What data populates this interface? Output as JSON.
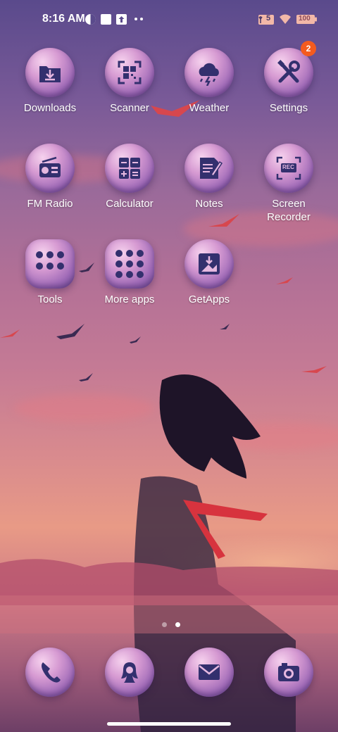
{
  "status_bar": {
    "time": "8:16 AM",
    "sim_label": "5",
    "battery_label": "100"
  },
  "apps": [
    {
      "label": "Downloads",
      "icon": "download-icon"
    },
    {
      "label": "Scanner",
      "icon": "qr-scanner-icon"
    },
    {
      "label": "Weather",
      "icon": "weather-cloud-icon"
    },
    {
      "label": "Settings",
      "icon": "tools-settings-icon",
      "badge": "2"
    },
    {
      "label": "FM Radio",
      "icon": "radio-icon"
    },
    {
      "label": "Calculator",
      "icon": "calculator-icon"
    },
    {
      "label": "Notes",
      "icon": "notes-icon"
    },
    {
      "label": "Screen Recorder",
      "icon": "screen-recorder-icon",
      "rec_text": "REC"
    },
    {
      "label": "Tools",
      "icon": "folder-icon"
    },
    {
      "label": "More apps",
      "icon": "folder-icon"
    },
    {
      "label": "GetApps",
      "icon": "getapps-icon"
    }
  ],
  "dock": [
    {
      "icon": "phone-icon"
    },
    {
      "icon": "contacts-icon"
    },
    {
      "icon": "messages-icon"
    },
    {
      "icon": "camera-icon"
    }
  ],
  "page_indicator": {
    "pages": 2,
    "active": 2
  },
  "colors": {
    "icon_glyph": "#33306e",
    "badge": "#f45b1f",
    "bubble": "#d69ad2"
  }
}
